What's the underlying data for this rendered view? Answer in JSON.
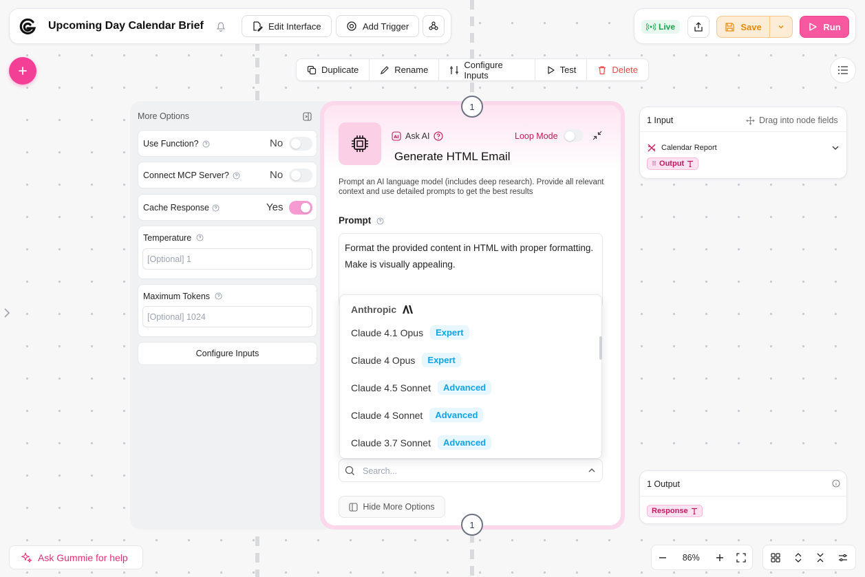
{
  "header": {
    "title": "Upcoming Day Calendar Brief",
    "edit_interface": "Edit Interface",
    "add_trigger": "Add Trigger"
  },
  "top_right": {
    "live": "Live",
    "save": "Save",
    "run": "Run"
  },
  "node_toolbar": {
    "duplicate": "Duplicate",
    "rename": "Rename",
    "configure_inputs": "Configure Inputs",
    "test": "Test",
    "delete": "Delete"
  },
  "more_options": {
    "title": "More Options",
    "use_function": {
      "label": "Use Function?",
      "value": "No"
    },
    "connect_mcp": {
      "label": "Connect MCP Server?",
      "value": "No"
    },
    "cache_response": {
      "label": "Cache Response",
      "value": "Yes"
    },
    "temperature": {
      "label": "Temperature",
      "placeholder": "[Optional] 1"
    },
    "max_tokens": {
      "label": "Maximum Tokens",
      "placeholder": "[Optional] 1024"
    },
    "configure_inputs": "Configure Inputs"
  },
  "node": {
    "step_top": "1",
    "step_bottom": "1",
    "type_label": "Ask AI",
    "loop_mode": "Loop Mode",
    "title": "Generate HTML Email",
    "description": "Prompt an AI language model (includes deep research). Provide all relevant context and use detailed prompts to get the best results",
    "prompt_label": "Prompt",
    "prompt_text": "Format the provided content in HTML with proper formatting. Make is visually appealing.",
    "hide_more_options": "Hide More Options",
    "search_placeholder": "Search..."
  },
  "model_dropdown": {
    "provider": "Anthropic",
    "models": [
      {
        "name": "Claude 4.1 Opus",
        "tier": "Expert"
      },
      {
        "name": "Claude 4 Opus",
        "tier": "Expert"
      },
      {
        "name": "Claude 4.5 Sonnet",
        "tier": "Advanced"
      },
      {
        "name": "Claude 4 Sonnet",
        "tier": "Advanced"
      },
      {
        "name": "Claude 3.7 Sonnet",
        "tier": "Advanced"
      }
    ]
  },
  "inputs_panel": {
    "title": "1 Input",
    "hint": "Drag into node fields",
    "item": "Calendar Report",
    "pill": "Output"
  },
  "outputs_panel": {
    "title": "1 Output",
    "pill": "Response"
  },
  "bottom": {
    "ask_gummie": "Ask Gummie for help",
    "zoom": "86%"
  },
  "colors": {
    "accent_pink": "#f43f96",
    "save_orange": "#f59e0b",
    "live_green": "#16a34a",
    "badge_blue": "#0ea5e9",
    "delete_red": "#ef4444"
  }
}
